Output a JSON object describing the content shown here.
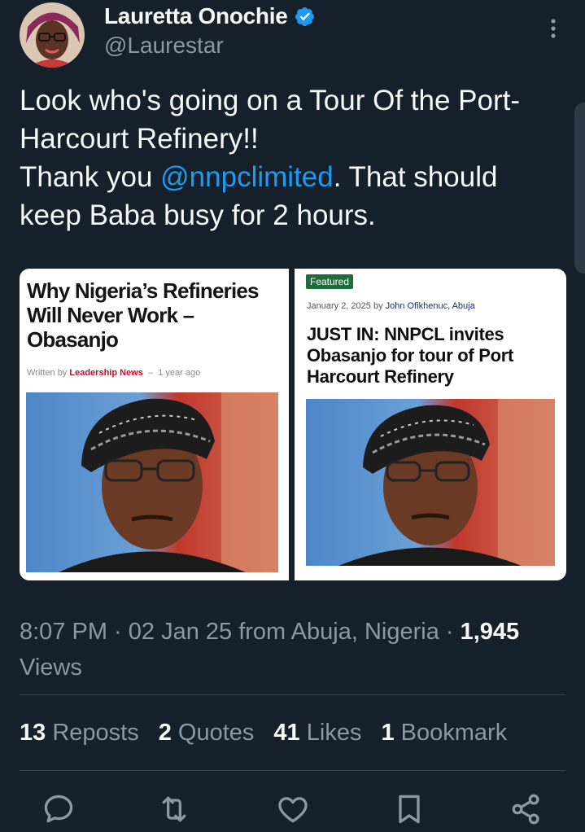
{
  "author": {
    "name": "Lauretta Onochie",
    "handle": "@Laurestar"
  },
  "tweet": {
    "line1": "Look who's going on a Tour Of the Port-Harcourt Refinery!!",
    "line2_prefix": "Thank you ",
    "mention": "@nnpclimited",
    "line2_suffix": ". That should keep Baba busy for 2 hours."
  },
  "media": {
    "left": {
      "headline": "Why Nigeria’s Refineries Will Never Work – Obasanjo",
      "written_by": "Written by",
      "source": "Leadership News",
      "separator": "–",
      "age": "1 year ago"
    },
    "right": {
      "badge": "Featured",
      "date": "January 2, 2025",
      "by": "by",
      "author": "John Ofikhenuc, Abuja",
      "headline": "JUST IN: NNPCL invites Obasanjo for tour of Port Harcourt Refinery"
    }
  },
  "meta": {
    "timestamp": "8:07 PM · 02 Jan 25 from Abuja, Nigeria · ",
    "views_count": "1,945",
    "views_label": "Views"
  },
  "stats": [
    {
      "count": "13",
      "label": "Reposts"
    },
    {
      "count": "2",
      "label": "Quotes"
    },
    {
      "count": "41",
      "label": "Likes"
    },
    {
      "count": "1",
      "label": "Bookmark"
    }
  ],
  "actions": [
    "reply-icon",
    "repost-icon",
    "like-icon",
    "bookmark-icon",
    "share-icon"
  ],
  "colors": {
    "background": "#15202b",
    "accent": "#1d9bf0",
    "secondary_text": "#8b98a5",
    "divider": "#38444d"
  }
}
